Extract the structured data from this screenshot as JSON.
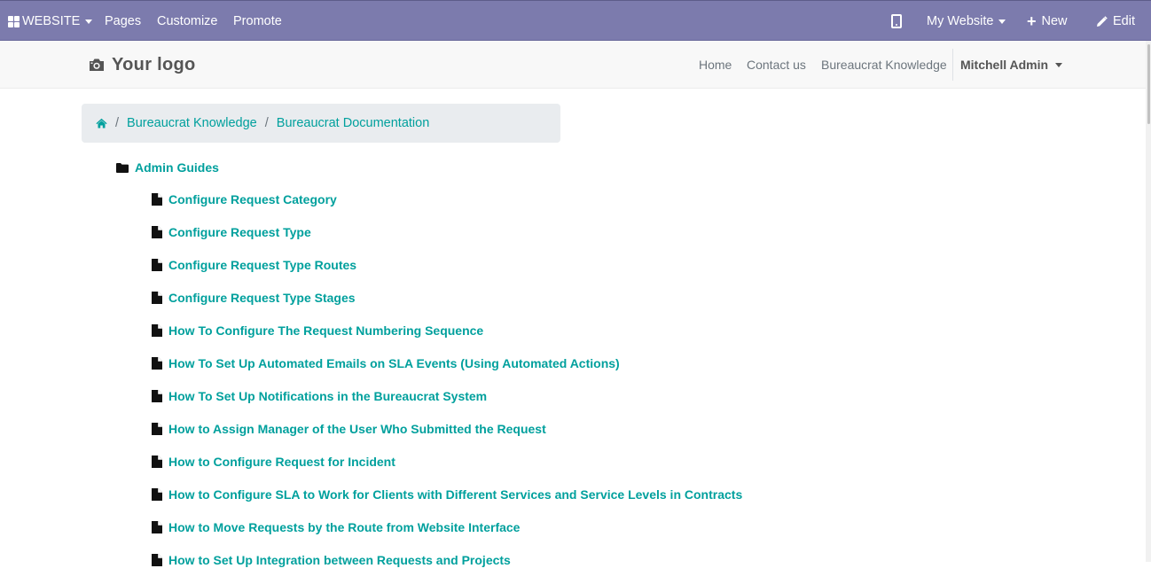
{
  "topbar": {
    "website_menu": "WEBSITE",
    "pages": "Pages",
    "customize": "Customize",
    "promote": "Promote",
    "my_website": "My Website",
    "new": "New",
    "edit": "Edit"
  },
  "header": {
    "logo": "Your logo",
    "nav": [
      "Home",
      "Contact us",
      "Bureaucrat Knowledge"
    ],
    "user": "Mitchell Admin"
  },
  "breadcrumb": [
    "Bureaucrat Knowledge",
    "Bureaucrat Documentation"
  ],
  "tree": {
    "folder": "Admin Guides",
    "documents": [
      "Configure Request Category",
      "Configure Request Type",
      "Configure Request Type Routes",
      "Configure Request Type Stages",
      "How To Configure The Request Numbering Sequence",
      "How To Set Up Automated Emails on SLA Events (Using Automated Actions)",
      "How To Set Up Notifications in the Bureaucrat System",
      "How to Assign Manager of the User Who Submitted the Request",
      "How to Configure Request for Incident",
      "How to Configure SLA to Work for Clients with Different Services and Service Levels in Contracts",
      "How to Move Requests by the Route from Website Interface",
      "How to Set Up Integration between Requests and Projects"
    ]
  },
  "colors": {
    "admin_bar": "#7c7bad",
    "link": "#00a09d",
    "header_bg": "#f8f8f8",
    "breadcrumb_bg": "#e9ecef"
  }
}
